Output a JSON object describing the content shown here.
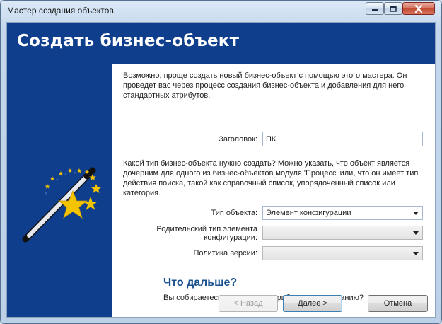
{
  "window": {
    "title": "Мастер создания объектов",
    "controls": {
      "minimize_icon": "minimize-icon",
      "maximize_icon": "maximize-icon",
      "close_icon": "close-icon"
    }
  },
  "banner": {
    "title": "Создать бизнес-объект"
  },
  "intro_text": "Возможно, проще создать новый бизнес-объект с помощью этого мастера. Он проведет вас через процесс создания бизнес-объекта и добавления для него стандартных атрибутов.",
  "form": {
    "caption_label": "Заголовок:",
    "caption_value": "ПК",
    "type_question": "Какой тип бизнес-объекта нужно создать? Можно указать, что объект является дочерним для одного из бизнес-объектов модуля 'Процесс' или, что он имеет тип действия поиска, такой как справочный список, упорядоченный список или категория.",
    "object_type_label": "Тип объекта:",
    "object_type_value": "Элемент конфигурации",
    "parent_type_label_line1": "Родительский тип элемента",
    "parent_type_label_line2": "конфигурации:",
    "parent_type_value": "",
    "version_policy_label": "Политика версии:",
    "version_policy_value": ""
  },
  "next_section": {
    "heading": "Что дальше?",
    "text": "Вы собираетесь создать ряд атрибутов по умолчанию?"
  },
  "buttons": {
    "back": "< Назад",
    "next": "Далее >",
    "cancel": "Отмена"
  },
  "colors": {
    "banner": "#0f3e8c",
    "heading": "#1b5390",
    "star": "#f5c400"
  },
  "icons": {
    "wizard": "magic-wand-icon",
    "dropdown": "chevron-down-icon"
  }
}
